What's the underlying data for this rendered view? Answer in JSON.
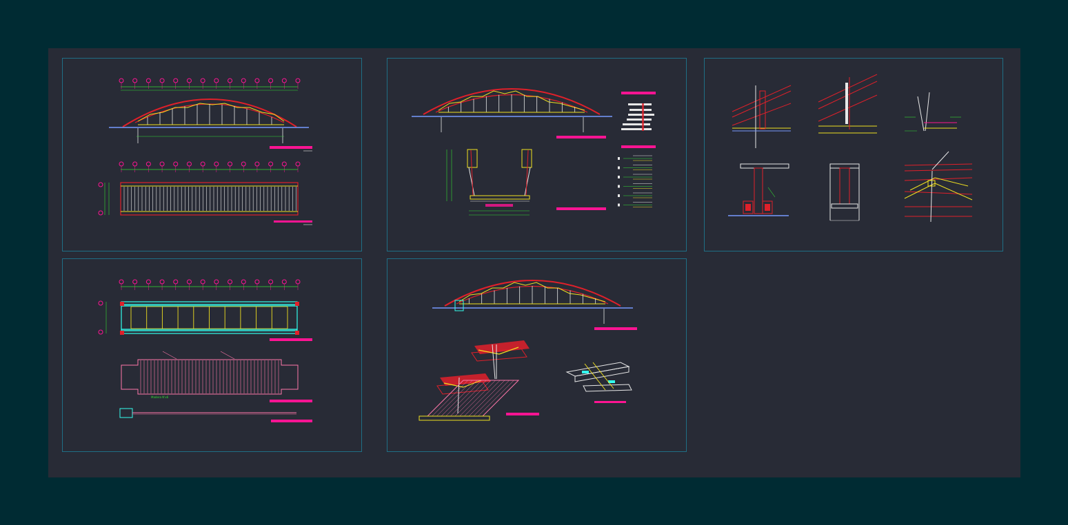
{
  "colors": {
    "outer_bg": "#002b33",
    "paper": "#282b36",
    "frame": "#1f6f86",
    "red": "#e0202a",
    "yellow": "#f0e020",
    "green": "#33dd33",
    "white": "#e8e8e8",
    "magenta": "#ff1493",
    "cyan": "#33ffee",
    "blue_ground": "#7799ff",
    "pink": "#ff77aa"
  },
  "sheets": [
    {
      "id": "elevation-and-plan",
      "content": [
        "truss-elevation",
        "deck-plan"
      ]
    },
    {
      "id": "section-and-schedule",
      "content": [
        "arch-truss",
        "u-cross-section",
        "member-schedule"
      ]
    },
    {
      "id": "connection-details",
      "content": [
        "node-details"
      ]
    },
    {
      "id": "deck-framing",
      "content": [
        "framing-plan",
        "planking-plan",
        "side-strip"
      ]
    },
    {
      "id": "isometric-details",
      "content": [
        "arch-truss",
        "isometric-joints"
      ]
    }
  ],
  "labels": {
    "lower_plan_text": "Madera N'x6"
  }
}
